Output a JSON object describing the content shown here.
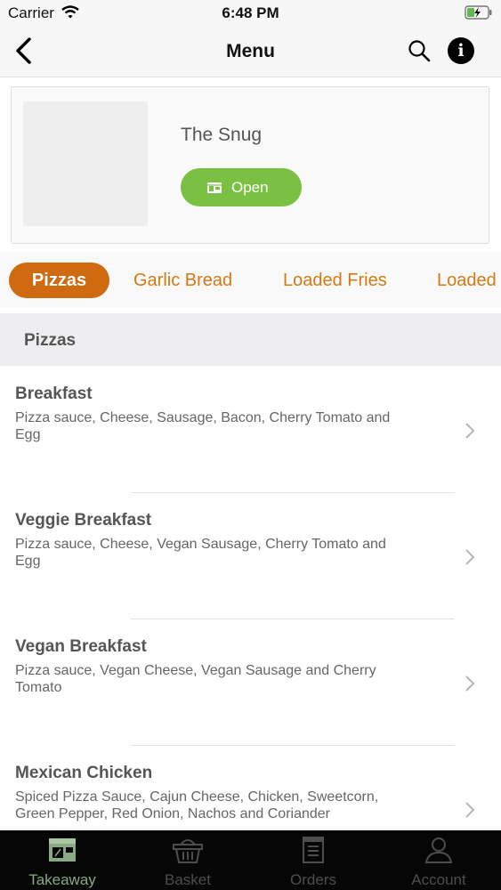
{
  "status_bar": {
    "carrier": "Carrier",
    "time": "6:48 PM"
  },
  "nav": {
    "title": "Menu"
  },
  "store": {
    "name": "The Snug",
    "status_label": "Open"
  },
  "categories": [
    "Pizzas",
    "Garlic Bread",
    "Loaded Fries",
    "Loaded"
  ],
  "section": {
    "title": "Pizzas"
  },
  "items": [
    {
      "name": "Breakfast",
      "description": "Pizza sauce, Cheese, Sausage, Bacon, Cherry Tomato and Egg"
    },
    {
      "name": "Veggie Breakfast",
      "description": "Pizza sauce, Cheese, Vegan Sausage, Cherry Tomato and Egg"
    },
    {
      "name": "Vegan Breakfast",
      "description": "Pizza sauce, Vegan Cheese, Vegan  Sausage and Cherry Tomato"
    },
    {
      "name": "Mexican Chicken",
      "description": "Spiced Pizza Sauce, Cajun Cheese, Chicken, Sweetcorn, Green Pepper, Red Onion, Nachos and Coriander"
    }
  ],
  "tabbar": {
    "items": [
      "Takeaway",
      "Basket",
      "Orders",
      "Account"
    ],
    "active": "Takeaway"
  },
  "colors": {
    "accent": "#cf6a10",
    "tab_text": "#d27a12",
    "open_green": "#7ac043",
    "active_tab_icon": "#8aa883"
  }
}
